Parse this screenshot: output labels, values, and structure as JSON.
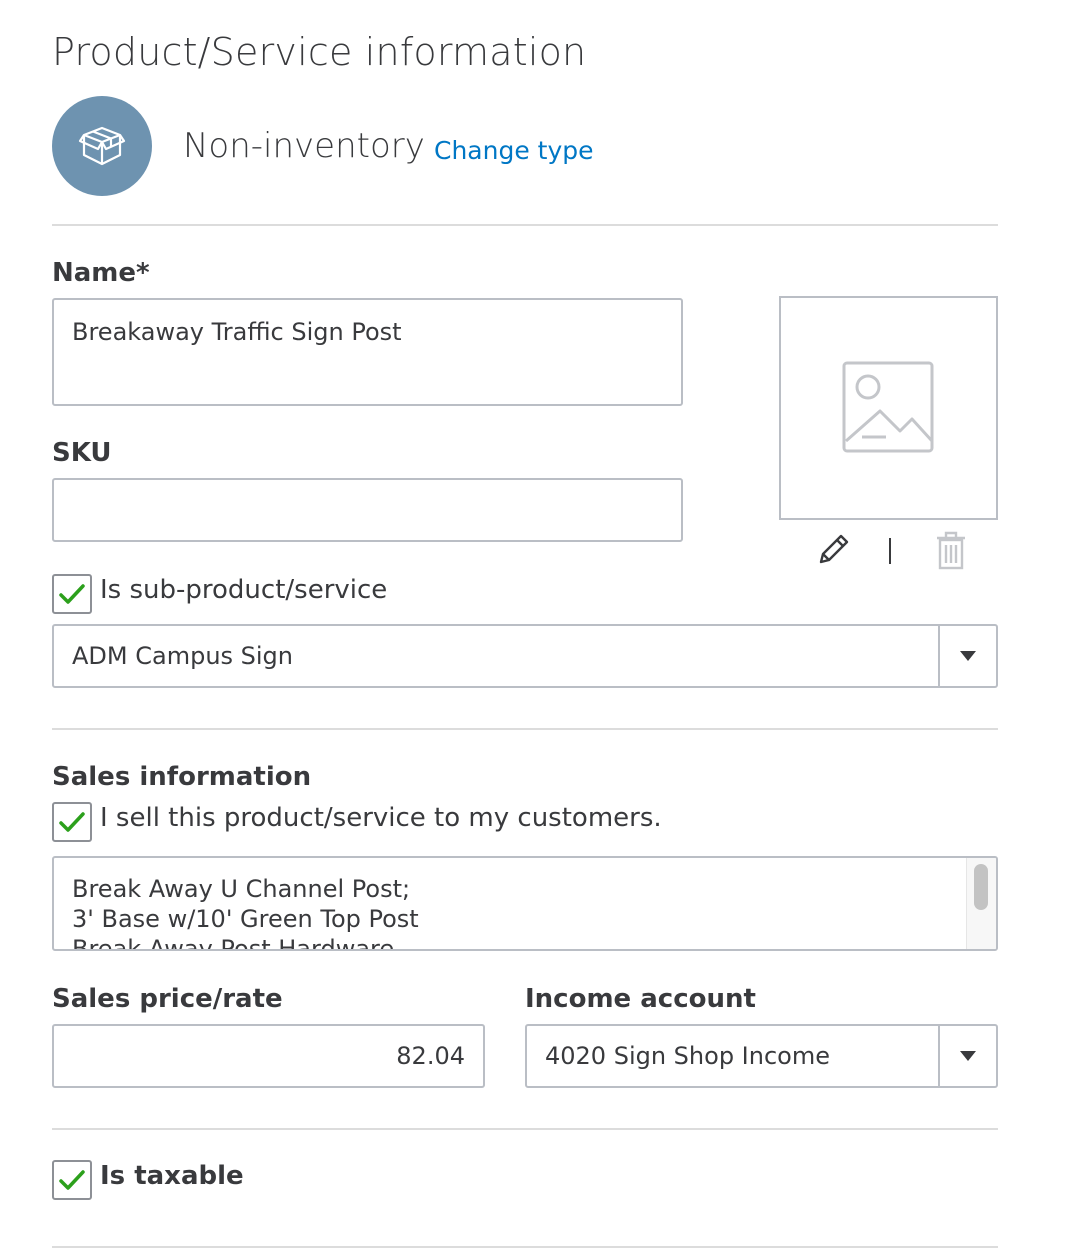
{
  "header": {
    "title": "Product/Service information",
    "type_label": "Non-inventory",
    "change_type_link": "Change type"
  },
  "name_field": {
    "label": "Name*",
    "value": "Breakaway Traffic Sign Post"
  },
  "sku_field": {
    "label": "SKU",
    "value": ""
  },
  "sub_product": {
    "checked": true,
    "label": "Is sub-product/service",
    "parent_value": "ADM Campus Sign"
  },
  "sales": {
    "section_title": "Sales information",
    "sell_checked": true,
    "sell_label": "I sell this product/service to my customers.",
    "description_lines": [
      "Break Away U Channel Post;",
      "3' Base w/10' Green Top Post",
      "Break Away Post Hardware"
    ],
    "price_label": "Sales price/rate",
    "price_value": "82.04",
    "income_label": "Income account",
    "income_value": "4020 Sign Shop Income"
  },
  "taxable": {
    "checked": true,
    "label": "Is taxable"
  },
  "colors": {
    "accent_link": "#0077c5",
    "check_green": "#2ca01c",
    "type_circle": "#6e93b0"
  }
}
